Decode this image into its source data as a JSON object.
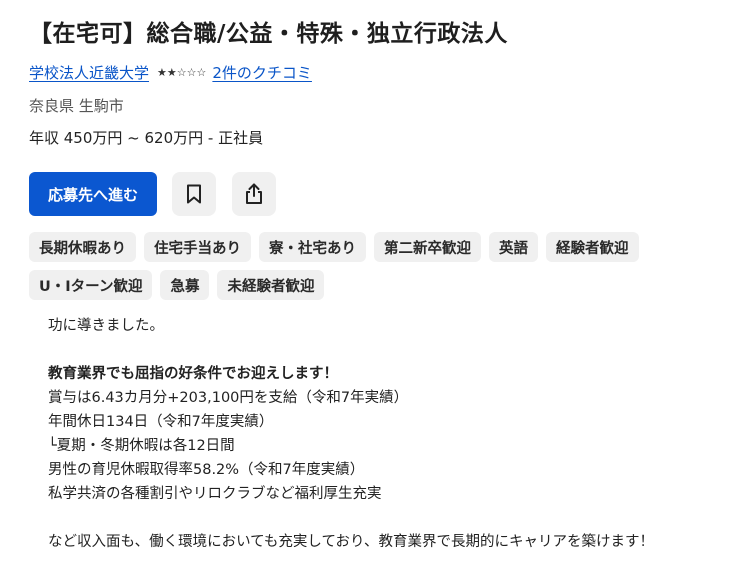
{
  "job": {
    "title": "【在宅可】総合職/公益・特殊・独立行政法人",
    "company": "学校法人近畿大学",
    "rating": {
      "stars_filled": 2,
      "stars_total": 5,
      "reviews_label": "2件のクチコミ"
    },
    "location": "奈良県 生駒市",
    "salary": "年収 450万円 ~ 620万円",
    "employment_type": "- 正社員"
  },
  "actions": {
    "apply_label": "応募先へ進む",
    "save_icon": "bookmark-icon",
    "share_icon": "share-icon"
  },
  "tags": [
    "長期休暇あり",
    "住宅手当あり",
    "寮・社宅あり",
    "第二新卒歓迎",
    "英語",
    "経験者歓迎",
    "U・Iターン歓迎",
    "急募",
    "未経験者歓迎"
  ],
  "description": {
    "lines": [
      {
        "text": "功に導きました。",
        "bold": false
      },
      {
        "text": "",
        "bold": false
      },
      {
        "text": "教育業界でも屈指の好条件でお迎えします！",
        "bold": true
      },
      {
        "text": "賞与は6.43カ月分+203,100円を支給（令和7年実績）",
        "bold": false
      },
      {
        "text": "年間休日134日（令和7年度実績）",
        "bold": false
      },
      {
        "text": "└夏期・冬期休暇は各12日間",
        "bold": false
      },
      {
        "text": "男性の育児休暇取得率58.2%（令和7年度実績）",
        "bold": false
      },
      {
        "text": "私学共済の各種割引やリロクラブなど福利厚生充実",
        "bold": false
      },
      {
        "text": "",
        "bold": false
      },
      {
        "text": "など収入面も、働く環境においても充実しており、教育業界で長期的にキャリアを築けます！",
        "bold": false
      }
    ]
  }
}
